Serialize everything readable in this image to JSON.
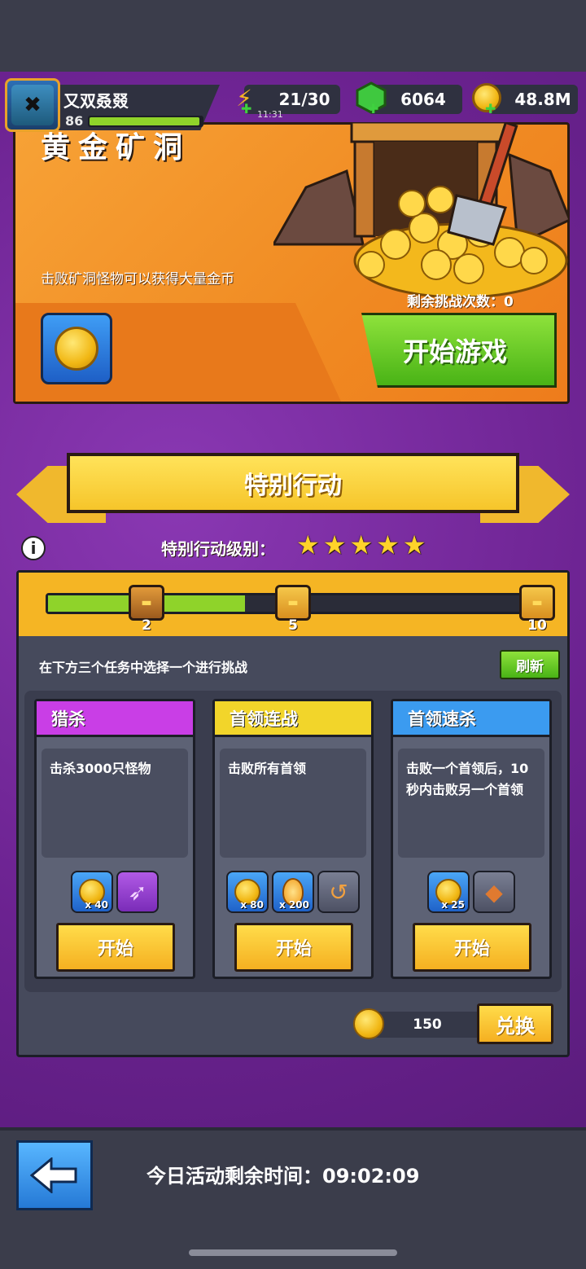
{
  "player": {
    "name": "又双叒叕",
    "level": "86",
    "xp_fraction": 0.98
  },
  "resources": {
    "energy": "21/30",
    "energy_timer": "11:31",
    "gems": "6064",
    "gold": "48.8M"
  },
  "mine": {
    "title": "黄金矿洞",
    "description": "击败矿洞怪物可以获得大量金币",
    "remaining_label": "剩余挑战次数：0",
    "start_button": "开始游戏"
  },
  "special": {
    "banner_title": "特别行动",
    "level_label": "特别行动级别：",
    "stars": [
      "★",
      "★",
      "★",
      "★",
      "★"
    ],
    "progress_fraction": 0.39,
    "milestones": [
      "2",
      "5",
      "10"
    ],
    "instruction": "在下方三个任务中选择一个进行挑战",
    "refresh_label": "刷新",
    "tasks": [
      {
        "title": "猎杀",
        "desc": "击杀3000只怪物",
        "head_color": "#c93ee6",
        "rewards": [
          {
            "icon": "coin-icon",
            "qty": "x 40"
          },
          {
            "icon": "kunai-icon",
            "qty": ""
          }
        ],
        "start_label": "开始"
      },
      {
        "title": "首领连战",
        "desc": "击败所有首领",
        "head_color": "#f2d52a",
        "rewards": [
          {
            "icon": "coin-icon",
            "qty": "x 80"
          },
          {
            "icon": "flame-icon",
            "qty": "x 200"
          },
          {
            "icon": "boomerang-icon",
            "qty": ""
          }
        ],
        "start_label": "开始"
      },
      {
        "title": "首领速杀",
        "desc": "击败一个首领后，10秒内击败另一个首领",
        "head_color": "#3b9bf0",
        "rewards": [
          {
            "icon": "coin-icon",
            "qty": "x 25"
          },
          {
            "icon": "armor-icon",
            "qty": ""
          }
        ],
        "start_label": "开始"
      }
    ],
    "exchange_value": "150",
    "exchange_label": "兑换"
  },
  "footer": {
    "timer_text": "今日活动剩余时间：09:02:09"
  }
}
